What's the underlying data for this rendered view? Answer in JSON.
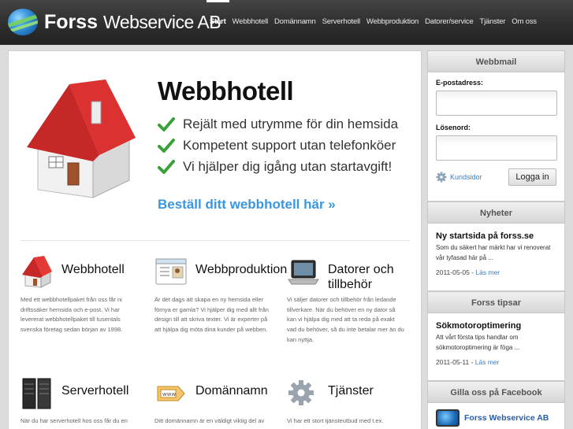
{
  "brand": {
    "name_bold": "Forss",
    "name_rest": "Webservice AB"
  },
  "nav": {
    "items": [
      {
        "label": "Start",
        "active": true
      },
      {
        "label": "Webbhotell"
      },
      {
        "label": "Domännamn"
      },
      {
        "label": "Serverhotell"
      },
      {
        "label": "Webbproduktion"
      },
      {
        "label": "Datorer/service"
      },
      {
        "label": "Tjänster"
      },
      {
        "label": "Om oss"
      }
    ]
  },
  "hero": {
    "title": "Webbhotell",
    "bullets": [
      "Rejält med utrymme för din hemsida",
      "Kompetent support utan telefonköer",
      "Vi hjälper dig igång utan startavgift!"
    ],
    "cta": "Beställ ditt webbhotell här »",
    "check_color": "#3aa13a",
    "cta_color": "#3b96e0"
  },
  "features": [
    {
      "title": "Webbhotell",
      "icon": "house-icon",
      "text": "Med ett webbhotellpaket från oss får ni driftssäker hemsida och e-post. Vi har levererat webbhotellpaket till tusentals svenska företag sedan början av 1998."
    },
    {
      "title": "Webbproduktion",
      "icon": "webpage-icon",
      "text": "Är det dags att skapa en ny hemsida eller förnya er gamla? Vi hjälper dig med allt från design till att skriva texter. Vi är experter på att hjälpa dig möta dina kunder på webben."
    },
    {
      "title": "Datorer och tillbehör",
      "title_line1": "Datorer och",
      "title_line2": "tillbehör",
      "icon": "laptop-icon",
      "text": "Vi säljer datorer och tillbehör från ledande tillverkare. När du behöver en ny dator så kan vi hjälpa dig med att ta reda på exakt vad du behöver, så du inte betalar mer än du kan nyttja."
    },
    {
      "title": "Serverhotell",
      "icon": "server-icon",
      "text": "När du har serverhotell hos oss får du en"
    },
    {
      "title": "Domännamn",
      "icon": "domain-tag-icon",
      "text": "Ditt domännamn är en väldigt viktig del av"
    },
    {
      "title": "Tjänster",
      "icon": "gear-icon",
      "text": "Vi har ett stort tjänsteutbud med t.ex."
    }
  ],
  "webmail": {
    "heading": "Webbmail",
    "email_label": "E-postadress:",
    "email_value": "",
    "password_label": "Lösenord:",
    "password_value": "",
    "kundsidor": "Kundsidor",
    "login_button": "Logga in"
  },
  "news": {
    "heading": "Nyheter",
    "title": "Ny startsida på forss.se",
    "text": "Som du säkert har märkt har vi renoverat vår tyfasad här på ...",
    "date": "2011-05-05",
    "more": "Läs mer"
  },
  "tips": {
    "heading": "Forss tipsar",
    "title": "Sökmotoroptimering",
    "text": "Att vårt första tips handlar om sökmotoroptimering är föga ...",
    "date": "2011-05-11",
    "more": "Läs mer"
  },
  "facebook": {
    "heading": "Gilla oss på Facebook",
    "page_name": "Forss Webservice AB"
  }
}
